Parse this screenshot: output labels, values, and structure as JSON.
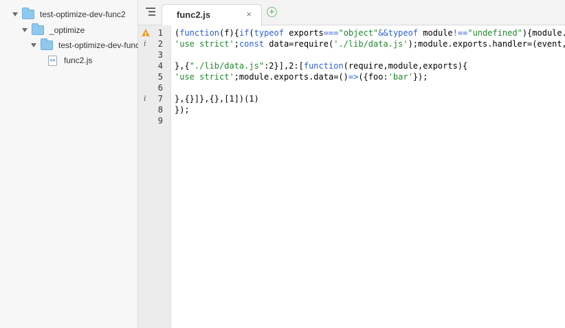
{
  "sidebar": {
    "tree": [
      {
        "label": "test-optimize-dev-func2",
        "type": "folder",
        "expanded": true
      },
      {
        "label": "_optimize",
        "type": "folder",
        "expanded": true
      },
      {
        "label": "test-optimize-dev-func",
        "type": "folder",
        "expanded": true
      },
      {
        "label": "func2.js",
        "type": "file",
        "icon": "js-file-icon"
      }
    ]
  },
  "tabs": {
    "menu_icon": "tabs-menu-icon",
    "active": {
      "title": "func2.js",
      "close": "×"
    },
    "new_tab": "+"
  },
  "editor": {
    "line_numbers": [
      "1",
      "2",
      "3",
      "4",
      "5",
      "6",
      "7",
      "8",
      "9"
    ],
    "gutter_markers": {
      "1": "warning",
      "2": "info",
      "7": "info"
    },
    "lines": [
      "(function(f){if(typeof exports===\"object\"&&typeof module!==\"undefined\"){module.",
      "'use strict';const data=require('./lib/data.js');module.exports.handler=(event,",
      "",
      "},{\"./lib/data.js\":2}],2:[function(require,module,exports){",
      "'use strict';module.exports.data=()=>({foo:'bar'});",
      "",
      "},{}]},{},[1])(1)",
      "});",
      ""
    ]
  },
  "colors": {
    "keyword": "#2b5fd9",
    "string": "#1e8a2e",
    "warning": "#f0a030",
    "folder": "#8fc9ee"
  }
}
